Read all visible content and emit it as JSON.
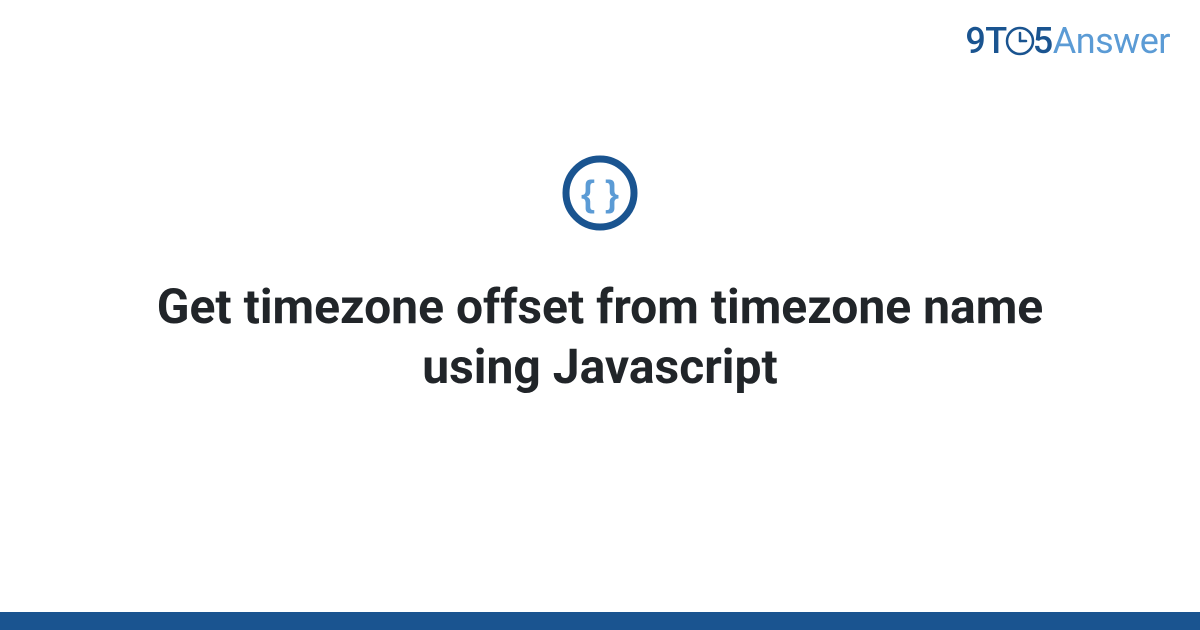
{
  "logo": {
    "part1": "9T",
    "part2": "5",
    "part3": "Answer"
  },
  "category_icon_name": "curly-braces-icon",
  "title": "Get timezone offset from timezone name using Javascript",
  "colors": {
    "brand_dark": "#1a5490",
    "brand_light": "#5b9bd5",
    "text": "#212529"
  }
}
